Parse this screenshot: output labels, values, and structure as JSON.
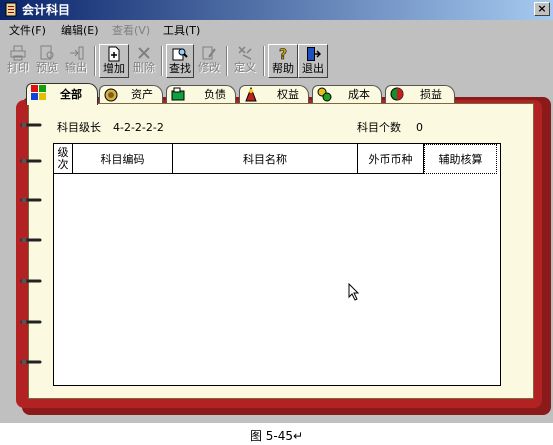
{
  "window": {
    "title": "会计科目",
    "close_label": "×"
  },
  "menu": [
    {
      "label": "文件(F)",
      "enabled": true
    },
    {
      "label": "编辑(E)",
      "enabled": true
    },
    {
      "label": "查看(V)",
      "enabled": false
    },
    {
      "label": "工具(T)",
      "enabled": true
    }
  ],
  "toolbar": {
    "print": {
      "label": "打印",
      "icon": "printer-icon",
      "enabled": false
    },
    "preview": {
      "label": "预览",
      "icon": "preview-icon",
      "enabled": false
    },
    "export": {
      "label": "输出",
      "icon": "export-icon",
      "enabled": false
    },
    "add": {
      "label": "增加",
      "icon": "add-document-icon",
      "enabled": true
    },
    "delete": {
      "label": "删除",
      "icon": "delete-x-icon",
      "enabled": false
    },
    "find": {
      "label": "查找",
      "icon": "find-icon",
      "enabled": true
    },
    "modify": {
      "label": "修改",
      "icon": "edit-icon",
      "enabled": false
    },
    "define": {
      "label": "定义",
      "icon": "define-icon",
      "enabled": false
    },
    "help": {
      "label": "帮助",
      "icon": "help-icon",
      "enabled": true
    },
    "exit": {
      "label": "退出",
      "icon": "exit-door-icon",
      "enabled": true
    }
  },
  "tabs": [
    {
      "label": "全部",
      "icon": "all-category-icon",
      "active": true
    },
    {
      "label": "资产",
      "icon": "assets-icon",
      "active": false
    },
    {
      "label": "负债",
      "icon": "liabilities-icon",
      "active": false
    },
    {
      "label": "权益",
      "icon": "equity-icon",
      "active": false
    },
    {
      "label": "成本",
      "icon": "cost-icon",
      "active": false
    },
    {
      "label": "损益",
      "icon": "profit-loss-icon",
      "active": false
    }
  ],
  "info": {
    "level_label": "科目级长",
    "level_value": "4-2-2-2-2",
    "count_label": "科目个数",
    "count_value": "0"
  },
  "table": {
    "columns": [
      "级次",
      "科目编码",
      "科目名称",
      "外币币种",
      "辅助核算"
    ],
    "rows": []
  },
  "caption": "图 5-45↵",
  "colors": {
    "notebook": "#b22222",
    "paper": "#fbfae0",
    "titlebar": "#0a246a"
  }
}
